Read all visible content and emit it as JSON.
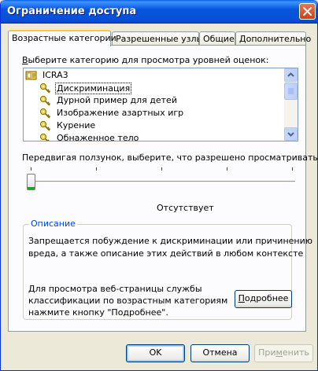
{
  "window": {
    "title": "Ограничение доступа"
  },
  "tabs": [
    {
      "label": "Возрастные категории"
    },
    {
      "label": "Разрешенные узлы"
    },
    {
      "label": "Общие"
    },
    {
      "label": "Дополнительно"
    }
  ],
  "category_prompt": {
    "u": "В",
    "rest": "ыберите категорию для просмотра уровней оценок:"
  },
  "tree": {
    "root": "ICRA3",
    "items": [
      {
        "label": "Дискриминация"
      },
      {
        "label": "Дурной пример для детей"
      },
      {
        "label": "Изображение азартных игр"
      },
      {
        "label": "Курение"
      },
      {
        "label": "Обнаженное тело"
      }
    ]
  },
  "slider": {
    "prompt_pre": "Пере",
    "prompt_u": "д",
    "prompt_post": "вигая ползунок, выберите, что разрешено просматривать:",
    "value_label": "Отсутствует",
    "position": 0
  },
  "description": {
    "title": "Описание",
    "text_line1": "Запрещается побуждение к дискриминации или причинению",
    "text_line2": "вреда, а также описание этих действий в любом контексте",
    "info_line1": "Для просмотра веб-страницы службы",
    "info_line2": "классификации по возрастным категориям",
    "info_line3": "нажмите кнопку \"Подробнее\".",
    "more_u": "П",
    "more_rest": "одробнее"
  },
  "buttons": {
    "ok": "OK",
    "cancel": "Отмена",
    "apply_pre": "При",
    "apply_u": "м",
    "apply_post": "енить"
  },
  "colors": {
    "titlebar": "#0855dd",
    "accent_tab": "#ffc83c",
    "group_title": "#0046d5"
  }
}
